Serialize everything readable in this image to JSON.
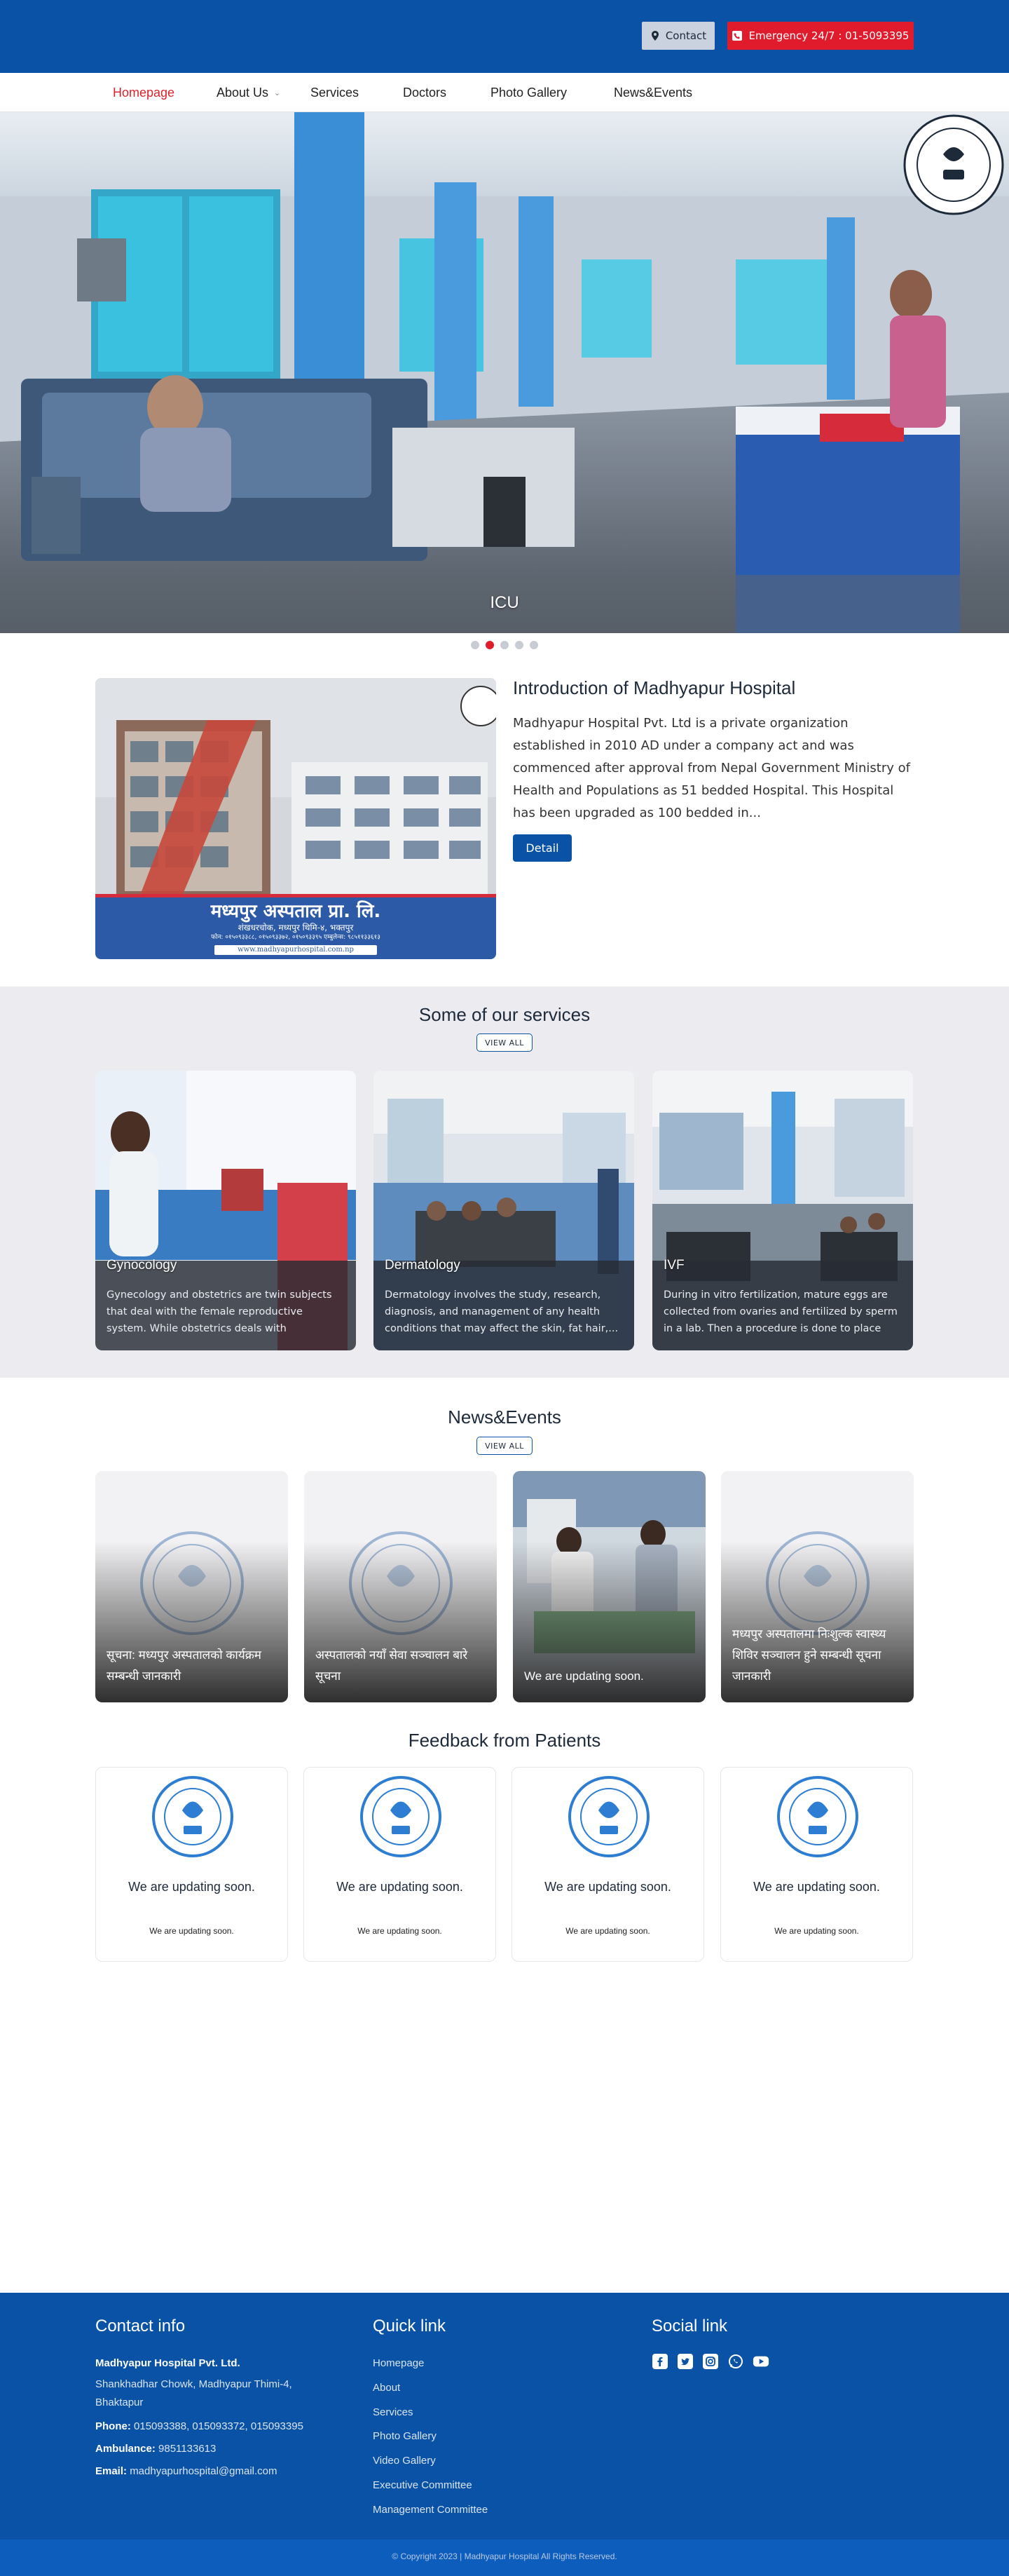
{
  "topbar": {
    "contact_label": "Contact",
    "emergency_label": "Emergency 24/7 : 01-5093395"
  },
  "nav": {
    "items": [
      "Homepage",
      "About Us",
      "Services",
      "Doctors",
      "Photo Gallery",
      "News&Events"
    ],
    "active": "Homepage"
  },
  "hero": {
    "caption": "ICU",
    "slide_count": 5,
    "active_slide": 2
  },
  "intro": {
    "title": "Introduction of Madhyapur Hospital",
    "text": "Madhyapur Hospital Pvt. Ltd is a private organization established in 2010 AD under a company act and was commenced after approval from Nepal Government Ministry of Health and Populations as 51 bedded Hospital. This Hospital has been upgraded as 100 bedded in...",
    "detail_label": "Detail",
    "sign_name": "मध्यपुर अस्पताल प्रा. लि.",
    "sign_address": "शंखधरचोक, मध्यपुर थिमि-४, भक्तपुर",
    "sign_phone": "फोन: ०१५०९३३८८, ०१५०९३३७२, ०१५०९३३९५ एम्बुलेन्स: ९८५११३३६१३",
    "sign_url": "www.madhyapurhospital.com.np"
  },
  "services": {
    "title": "Some of our services",
    "view_all": "VIEW ALL",
    "cards": [
      {
        "title": "Gynocology",
        "desc": "Gynecology and obstetrics are twin subjects that deal with the female reproductive system. While obstetrics deals with pregnanc..."
      },
      {
        "title": "Dermatology",
        "desc": "Dermatology involves the study, research, diagnosis, and management of any health conditions that may affect the skin, fat hair,..."
      },
      {
        "title": "IVF",
        "desc": "During in vitro fertilization, mature eggs are collected from ovaries and fertilized by sperm in a lab. Then a procedure is done to place on..."
      }
    ]
  },
  "news": {
    "title": "News&Events",
    "view_all": "VIEW ALL",
    "cards": [
      {
        "title": "सूचना: मध्यपुर अस्पतालको कार्यक्रम सम्बन्धी जानकारी"
      },
      {
        "title": "अस्पतालको नयाँ सेवा सञ्चालन बारे सूचना"
      },
      {
        "title": "We are updating soon."
      },
      {
        "title": "मध्यपुर अस्पतालमा निःशुल्क स्वास्थ्य शिविर सञ्चालन हुने सम्बन्धी सूचना जानकारी"
      }
    ]
  },
  "feedback": {
    "title": "Feedback from Patients",
    "cards": [
      {
        "title": "We are updating soon.",
        "sub": "We are updating soon."
      },
      {
        "title": "We are updating soon.",
        "sub": "We are updating soon."
      },
      {
        "title": "We are updating soon.",
        "sub": "We are updating soon."
      },
      {
        "title": "We are updating soon.",
        "sub": "We are updating soon."
      }
    ]
  },
  "footer": {
    "contact_title": "Contact info",
    "org_name": "Madhyapur Hospital Pvt. Ltd.",
    "address": "Shankhadhar Chowk, Madhyapur Thimi-4, Bhaktapur",
    "phone_label": "Phone:",
    "phone": "015093388, 015093372, 015093395",
    "ambulance_label": "Ambulance:",
    "ambulance": "9851133613",
    "email_label": "Email:",
    "email": "madhyapurhospital@gmail.com",
    "quick_title": "Quick link",
    "quick_links": [
      "Homepage",
      "About",
      "Services",
      "Photo Gallery",
      "Video Gallery",
      "Executive Committee",
      "Management Committee"
    ],
    "social_title": "Social link",
    "social_icons": [
      "facebook-icon",
      "twitter-icon",
      "instagram-icon",
      "whatsapp-icon",
      "youtube-icon"
    ],
    "copyright": "© Copyright 2023 | Madhyapur Hospital All Rights Reserved."
  },
  "colors": {
    "brand_blue": "#0a52a5",
    "accent_red": "#e01b2c",
    "section_gray": "#ececf0"
  }
}
